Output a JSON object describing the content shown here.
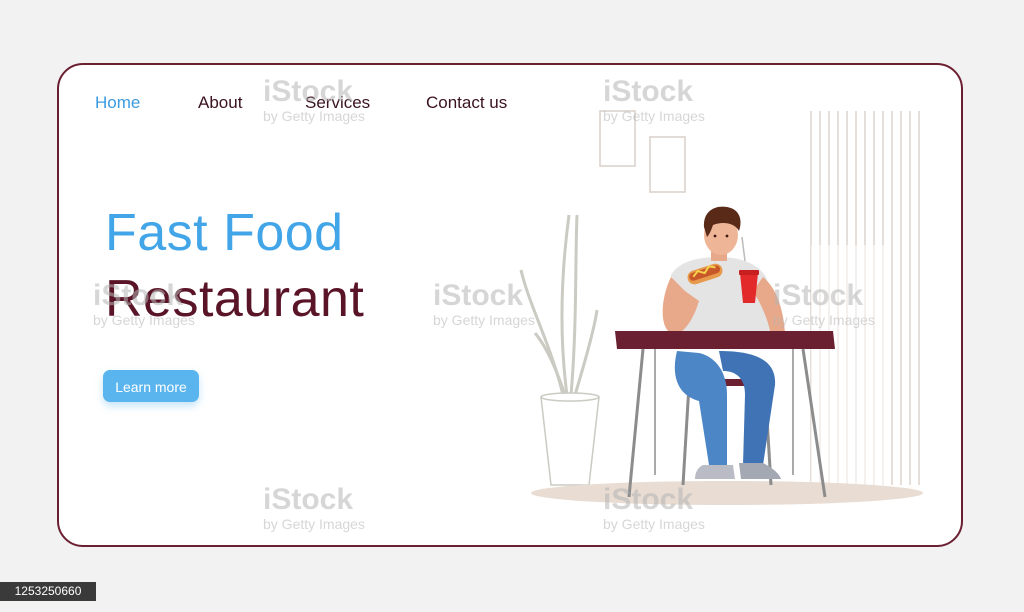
{
  "nav": {
    "items": [
      {
        "label": "Home",
        "active": true
      },
      {
        "label": "About",
        "active": false
      },
      {
        "label": "Services",
        "active": false
      },
      {
        "label": "Contact us",
        "active": false
      }
    ]
  },
  "hero": {
    "title_line1": "Fast Food",
    "title_line2": "Restaurant",
    "cta_label": "Learn more"
  },
  "illustration": {
    "icon": "man-eating-hotdog-illustration"
  },
  "watermark": {
    "brand": "iStock",
    "sub": "by Getty Images"
  },
  "image_id": "1253250660",
  "colors": {
    "accent": "#42a5e8",
    "brand_dark": "#5a1428",
    "button": "#5ab5ee",
    "frame_border": "#6b2032"
  }
}
